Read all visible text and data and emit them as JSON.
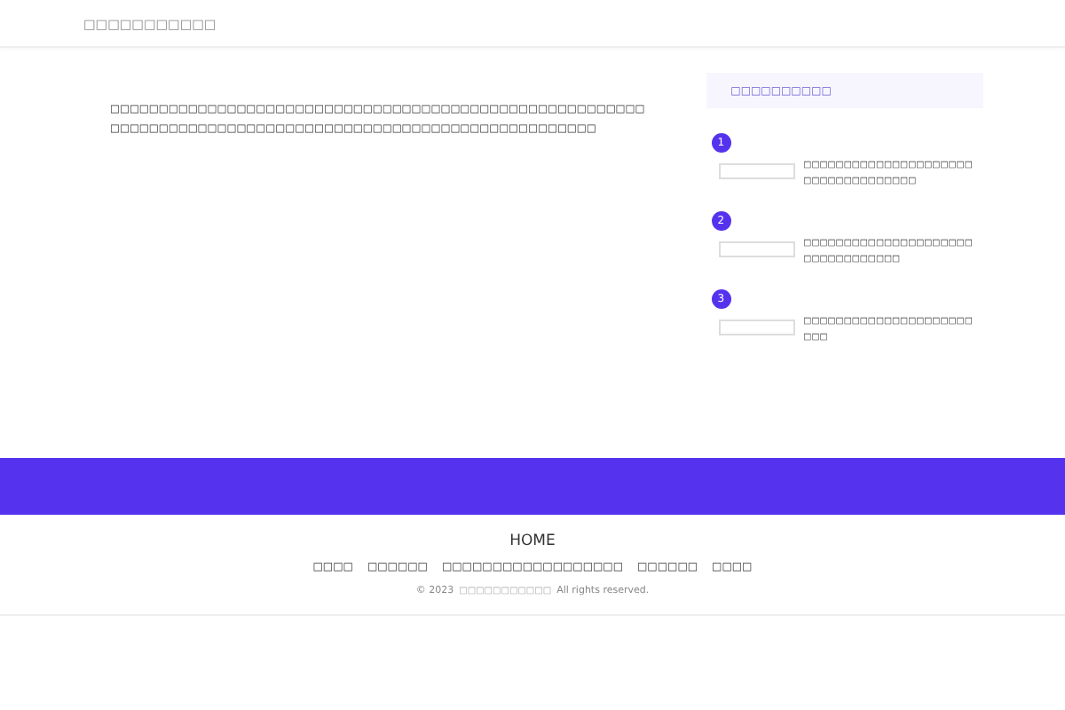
{
  "header": {
    "site_title": "□□□□□□□□□□□"
  },
  "article": {
    "text": "□□□□□□□□□□□□□□□□□□□□□□□□□□□□□□□□□□□□□□□□□□□□□□□□□□□□□□□□□□□□□□□□□□□□□□□□□□□□□□□□□□□□□□□□□□□□□□□□□□□□□□□□□"
  },
  "sidebar": {
    "heading": "□□□□□□□□□□",
    "items": [
      {
        "rank": "1",
        "title": "□□□□□□□□□□□□□□□□□□□□□□□□□□□□□□□□□□□"
      },
      {
        "rank": "2",
        "title": "□□□□□□□□□□□□□□□□□□□□□□□□□□□□□□□□□"
      },
      {
        "rank": "3",
        "title": "□□□□□□□□□□□□□□□□□□□□□□□□"
      }
    ]
  },
  "footer": {
    "home": "HOME",
    "links": [
      "□□□□",
      "□□□□□□",
      "□□□□□□□□□□□□□□□□□□",
      "□□□□□□",
      "□□□□"
    ],
    "copyright_prefix": "© 2023",
    "copyright_site": "□□□□□□□□□□□",
    "copyright_suffix": "All rights reserved."
  }
}
